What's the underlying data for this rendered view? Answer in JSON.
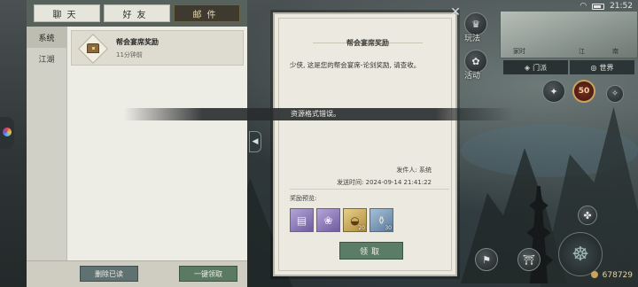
{
  "status": {
    "time": "21:52"
  },
  "top_tabs": [
    {
      "label": "聊天",
      "active": false
    },
    {
      "label": "好友",
      "active": false
    },
    {
      "label": "邮件",
      "active": true
    }
  ],
  "categories": [
    {
      "label": "系统",
      "active": true
    },
    {
      "label": "江湖",
      "active": false
    }
  ],
  "mail_list": [
    {
      "title": "帮会宴席奖励",
      "time": "11分钟前"
    }
  ],
  "bottom_bar": {
    "delete_read": "删除已读",
    "collect_all": "一键领取"
  },
  "detail": {
    "title": "帮会宴席奖励",
    "body": "少侠, 这是您的帮会宴席-论剑奖励, 请查收。",
    "sender": "发件人: 系统",
    "send_time": "发送时间: 2024-09-14 21:41:22",
    "reward_label": "奖励预览:",
    "rewards": [
      {
        "count": "",
        "color": "purple"
      },
      {
        "count": "",
        "color": "purple"
      },
      {
        "count": "20",
        "color": "gold"
      },
      {
        "count": "30",
        "color": "blue"
      }
    ],
    "collect": "领取"
  },
  "toast": "资源格式错误。",
  "map": {
    "tabs": [
      "门派",
      "世界"
    ],
    "badge": "50",
    "labels": [
      "玩法",
      "活动"
    ],
    "minimap_labels": [
      "家时",
      "江",
      "南"
    ],
    "currency": "678729"
  }
}
